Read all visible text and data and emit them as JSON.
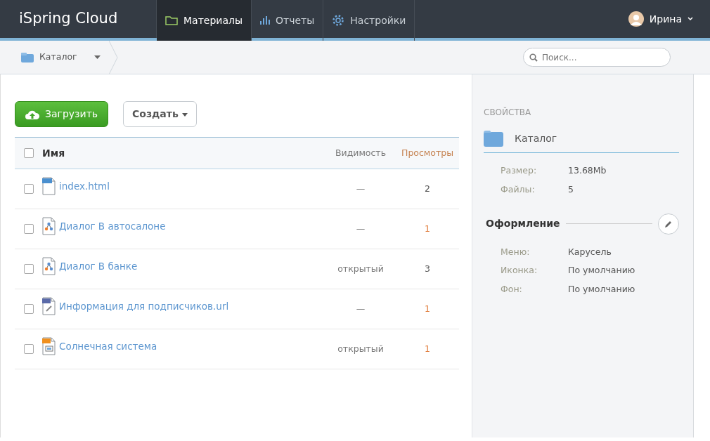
{
  "brand": "iSpring Cloud",
  "nav": [
    {
      "label": "Материалы",
      "kind": "folder",
      "selected": true
    },
    {
      "label": "Отчеты",
      "kind": "bars",
      "selected": false
    },
    {
      "label": "Настройки",
      "kind": "gear",
      "selected": false
    }
  ],
  "user": {
    "name": "Ирина"
  },
  "breadcrumb": {
    "label": "Каталог"
  },
  "search": {
    "placeholder": "Поиск..."
  },
  "buttons": {
    "upload": "Загрузить",
    "create": "Создать"
  },
  "table": {
    "columns": [
      "Имя",
      "Видимость",
      "Просмотры"
    ],
    "all_checked": false,
    "rows": [
      {
        "kind": "html",
        "name": "index.html",
        "visibility": "—",
        "views": "2",
        "views_highlighted": false,
        "checked": false
      },
      {
        "kind": "dialog",
        "name": "Диалог В автосалоне",
        "visibility": "—",
        "views": "1",
        "views_highlighted": true,
        "checked": false
      },
      {
        "kind": "dialog",
        "name": "Диалог В банке",
        "visibility": "открытый",
        "views": "3",
        "views_highlighted": false,
        "checked": false
      },
      {
        "kind": "url",
        "name": "Информация для подписчиков.url",
        "visibility": "—",
        "views": "1",
        "views_highlighted": true,
        "checked": false
      },
      {
        "kind": "ppt",
        "name": "Солнечная система",
        "visibility": "открытый",
        "views": "1",
        "views_highlighted": true,
        "checked": false
      }
    ]
  },
  "properties": {
    "heading": "СВОЙСТВА",
    "title": "Каталог",
    "fields": [
      {
        "label": "Размер:",
        "value": "13.68Mb"
      },
      {
        "label": "Файлы:",
        "value": "5"
      }
    ],
    "design_heading": "Оформление",
    "design_fields": [
      {
        "label": "Меню:",
        "value": "Карусель"
      },
      {
        "label": "Иконка:",
        "value": "По умолчанию"
      },
      {
        "label": "Фон:",
        "value": "По умолчанию"
      }
    ]
  }
}
